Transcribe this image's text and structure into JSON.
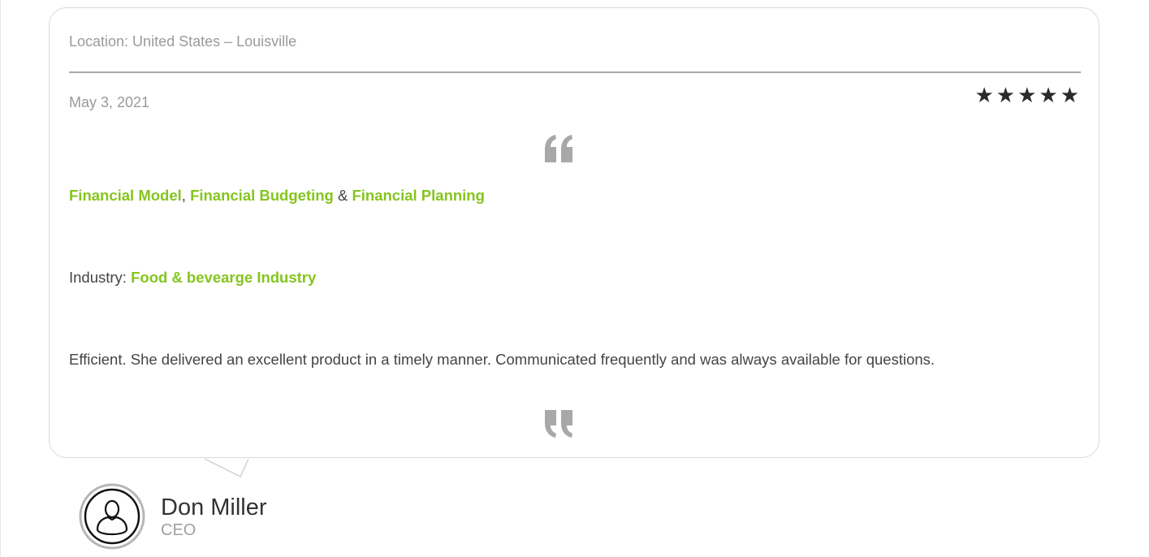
{
  "testimonial": {
    "location": "Location: United States – Louisville",
    "date": "May 3, 2021",
    "rating": 5,
    "star_glyph": "★",
    "quote_open_icon": "quote-open-icon",
    "quote_close_icon": "quote-close-icon",
    "services": {
      "item1": "Financial Model",
      "sep1": ", ",
      "item2": "Financial Budgeting",
      "sep2": " & ",
      "item3": "Financial Planning"
    },
    "industry": {
      "label": "Industry: ",
      "value": "Food & bevearge Industry"
    },
    "review_text": "Efficient. She delivered an excellent product in a timely manner. Communicated frequently and was always available for questions."
  },
  "author": {
    "name": "Don Miller",
    "role": "CEO",
    "avatar_icon": "user-avatar-icon"
  },
  "colors": {
    "accent_green": "#85c51d",
    "muted_text": "#9a9a9a",
    "body_text": "#444444",
    "star_color": "#2b2b2b",
    "quote_icon": "#a8a8a8",
    "card_border": "#d9d9d9"
  }
}
